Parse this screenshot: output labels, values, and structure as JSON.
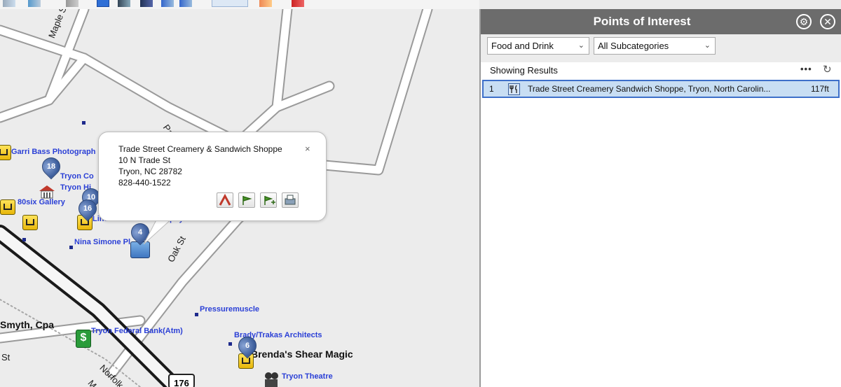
{
  "panel": {
    "title": "Points of Interest",
    "settings_icon": "gear-icon",
    "close_icon": "close-icon",
    "category_select": "Food and Drink",
    "subcategory_select": "All Subcategories",
    "results_label": "Showing Results",
    "more_icon": "more-dots-icon",
    "refresh_icon": "refresh-icon",
    "results": [
      {
        "index": "1",
        "icon": "restaurant-icon",
        "name": "Trade Street Creamery  Sandwich Shoppe, Tryon, North Carolin...",
        "distance": "117ft"
      }
    ]
  },
  "popup": {
    "name": "Trade Street Creamery & Sandwich Shoppe",
    "address": "10 N Trade St",
    "city": "Tryon, NC 28782",
    "phone": "828-440-1522",
    "close_label": "×"
  },
  "map": {
    "streets": {
      "maple": "Maple St",
      "pal": "Pal",
      "oak": "Oak St",
      "trade_st": "St",
      "norfolk": "Norfolk",
      "m": "M"
    },
    "pois": {
      "garri": "Garri Bass Photograph",
      "tryon_co": "Tryon Co",
      "tryon_hi": "Tryon Hi",
      "eightysix": "80six Gallery",
      "linda": "Linda Bass Photography",
      "nina": "Nina Simone Pl",
      "pressure": "Pressuremuscle",
      "bank": "Tryon Federal Bank(Atm)",
      "brady": "Brady/Trakas Architects",
      "theatre": "Tryon Theatre"
    },
    "big_labels": {
      "smyth": "Smyth, Cpa",
      "brenda": "Brenda's Shear Magic"
    },
    "pins": [
      "18",
      "10",
      "16",
      "4",
      "6"
    ],
    "highway": "176"
  },
  "colors": {
    "panel_header": "#6c6c6c",
    "selected_row": "#c8def3",
    "selected_border": "#3d6fc9",
    "poi_label": "#2a3fd6"
  }
}
